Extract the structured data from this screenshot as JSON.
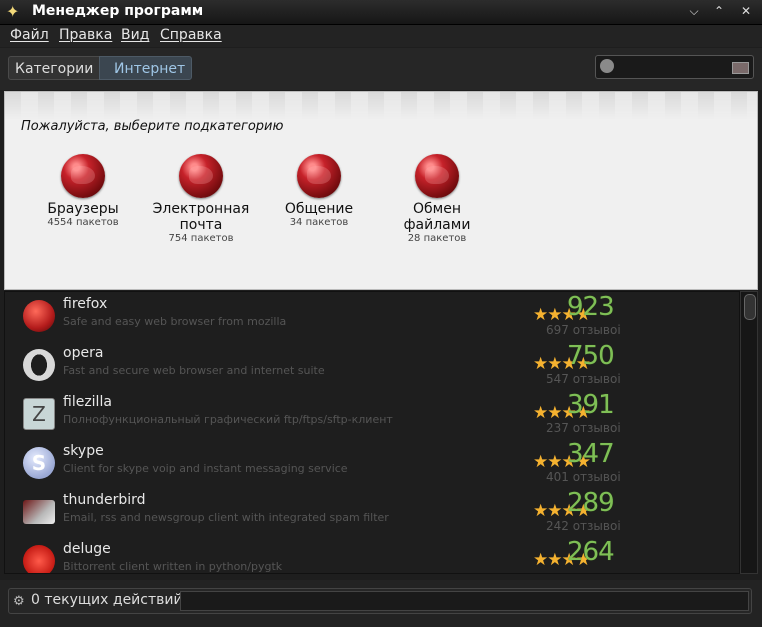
{
  "window": {
    "title": "Менеджер программ",
    "app_icon": "sparkle-icon",
    "min": "⌵",
    "max": "⌃",
    "close": "✕"
  },
  "menu": [
    "Файл",
    "Правка",
    "Вид",
    "Справка"
  ],
  "breadcrumb": [
    "Категории",
    "Интернет"
  ],
  "search": {
    "placeholder": ""
  },
  "subcategory": {
    "prompt": "Пожалуйста, выберите подкатегорию",
    "items": [
      {
        "name": "Браузеры",
        "count": "4554 пакетов"
      },
      {
        "name": "Электронная почта",
        "count": "754 пакетов"
      },
      {
        "name": "Общение",
        "count": "34 пакетов"
      },
      {
        "name": "Обмен файлами",
        "count": "28 пакетов"
      }
    ]
  },
  "apps": [
    {
      "name": "firefox",
      "desc": "Safe and easy web browser from mozilla",
      "stars": "★★★★",
      "score": "923",
      "reviews": "697 отзывоi",
      "icon": "firefox-icon",
      "color": "#b31b1b"
    },
    {
      "name": "opera",
      "desc": "Fast and secure web browser and internet suite",
      "stars": "★★★★",
      "score": "750",
      "reviews": "547 отзывоi",
      "icon": "opera-icon",
      "color": "#d0d0d0"
    },
    {
      "name": "filezilla",
      "desc": "Полнофункциональный графический ftp/ftps/sftp-клиент",
      "stars": "★★★★",
      "score": "391",
      "reviews": "237 отзывоi",
      "icon": "filezilla-icon",
      "color": "#b8c8c8"
    },
    {
      "name": "skype",
      "desc": "Client for skype voip and instant messaging service",
      "stars": "★★★★",
      "score": "347",
      "reviews": "401 отзывоi",
      "icon": "skype-icon",
      "color": "#b6c2e6"
    },
    {
      "name": "thunderbird",
      "desc": "Email, rss and newsgroup client with integrated spam filter",
      "stars": "★★★★",
      "score": "289",
      "reviews": "242 отзывоi",
      "icon": "thunderbird-icon",
      "color": "#7a1e1e"
    },
    {
      "name": "deluge",
      "desc": "Bittorrent client written in python/pygtk",
      "stars": "★★★★",
      "score": "264",
      "reviews": "",
      "icon": "deluge-icon",
      "color": "#d7261e"
    }
  ],
  "status": {
    "text": "0 текущих действий"
  },
  "colors": {
    "accent": "#9fc6e6",
    "score": "#7fbf56",
    "star": "#f5b230",
    "globe": "#c6222a"
  }
}
